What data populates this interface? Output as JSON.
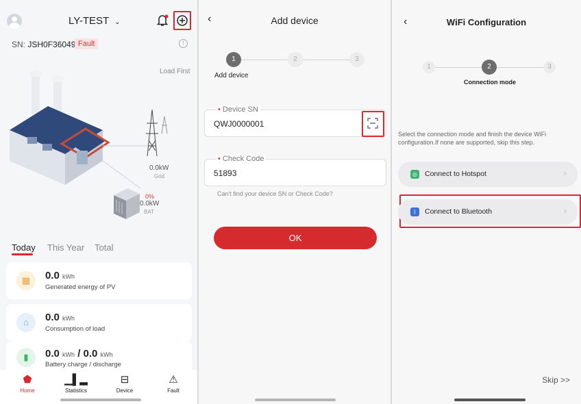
{
  "panel1": {
    "title": "LY-TEST",
    "sn_prefix": "SN:",
    "sn_value": "JSH0F36049",
    "fault_badge": "Fault",
    "load_first": "Load First",
    "grid_value": "0.0kW",
    "grid_label": "Grid",
    "bat_percent": "0%",
    "bat_value": "0.0kW",
    "bat_label": "BAT",
    "tabs": [
      "Today",
      "This Year",
      "Total"
    ],
    "cards": [
      {
        "value": "0.0",
        "unit": "kWh",
        "label": "Generated energy of PV",
        "icon": "solar-panel-icon"
      },
      {
        "value": "0.0",
        "unit": "kWh",
        "label": "Consumption of load",
        "icon": "home-load-icon"
      },
      {
        "value": "0.0",
        "unit": "kWh",
        "value2": "0.0",
        "unit2": "kWh",
        "label": "Battery charge / discharge",
        "icon": "battery-icon"
      }
    ],
    "nav": [
      "Home",
      "Statistics",
      "Device",
      "Fault"
    ]
  },
  "panel2": {
    "title": "Add device",
    "steps": [
      "1",
      "2",
      "3"
    ],
    "step_label": "Add device",
    "sn_label": "Device SN",
    "sn_value": "QWJ0000001",
    "code_label": "Check Code",
    "code_value": "51893",
    "hint": "Can't find your device SN or Check Code?",
    "ok": "OK"
  },
  "panel3": {
    "title": "WiFi Configuration",
    "steps": [
      "1",
      "2",
      "3"
    ],
    "step_label": "Connection mode",
    "description": "Select the connection mode and finish the device WiFi configuration.If none are supported, skip this step.",
    "options": [
      "Connect to Hotspot",
      "Connect to Bluetooth"
    ],
    "skip": "Skip >>"
  },
  "colors": {
    "accent": "#d52b2e",
    "highlight_box": "#e0252b"
  }
}
